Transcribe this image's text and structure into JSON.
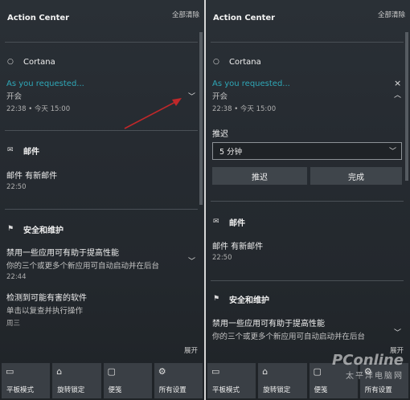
{
  "left": {
    "header": {
      "title": "Action Center",
      "clear_all": "全部清除"
    },
    "cortana": {
      "group_title": "Cortana",
      "notif": {
        "title": "As you requested...",
        "body": "开会",
        "time": "22:38 • 今天 15:00"
      }
    },
    "mail": {
      "group_title": "邮件",
      "notif": {
        "title": "邮件 有新邮件",
        "time": "22:50"
      }
    },
    "security": {
      "group_title": "安全和维护",
      "notif1": {
        "title": "禁用一些应用可有助于提高性能",
        "body": "你的三个或更多个新应用可自动启动并在后台",
        "time": "22:44"
      },
      "notif2": {
        "title": "检测到可能有害的软件",
        "body": "单击以复查并执行操作",
        "time": "周三"
      }
    },
    "expand": "展开",
    "tiles": [
      {
        "label": "平板模式",
        "icon": "tablet-mode-icon"
      },
      {
        "label": "旋转锁定",
        "icon": "rotation-lock-icon"
      },
      {
        "label": "便笺",
        "icon": "note-icon"
      },
      {
        "label": "所有设置",
        "icon": "settings-gear-icon"
      }
    ]
  },
  "right": {
    "header": {
      "title": "Action Center",
      "clear_all": "全部清除"
    },
    "cortana": {
      "group_title": "Cortana",
      "notif": {
        "title": "As you requested...",
        "body": "开会",
        "time": "22:38 • 今天 15:00"
      },
      "close": "×",
      "collapse": "︿",
      "snooze_label": "推迟",
      "snooze_value": "5 分钟",
      "snooze_button": "推迟",
      "done_button": "完成"
    },
    "mail": {
      "group_title": "邮件",
      "notif": {
        "title": "邮件 有新邮件",
        "time": "22:50"
      }
    },
    "security": {
      "group_title": "安全和维护",
      "notif1": {
        "title": "禁用一些应用可有助于提高性能",
        "body": "你的三个或更多个新应用可自动启动并在后台"
      }
    },
    "expand": "展开",
    "tiles": [
      {
        "label": "平板模式",
        "icon": "tablet-mode-icon"
      },
      {
        "label": "旋转锁定",
        "icon": "rotation-lock-icon"
      },
      {
        "label": "便笺",
        "icon": "note-icon"
      },
      {
        "label": "所有设置",
        "icon": "settings-gear-icon"
      }
    ],
    "watermark": {
      "brand": "PConline",
      "sub": "太平洋电脑网"
    }
  },
  "colors": {
    "accent": "#2fa7b7",
    "annotation_arrow": "#c0282a"
  }
}
